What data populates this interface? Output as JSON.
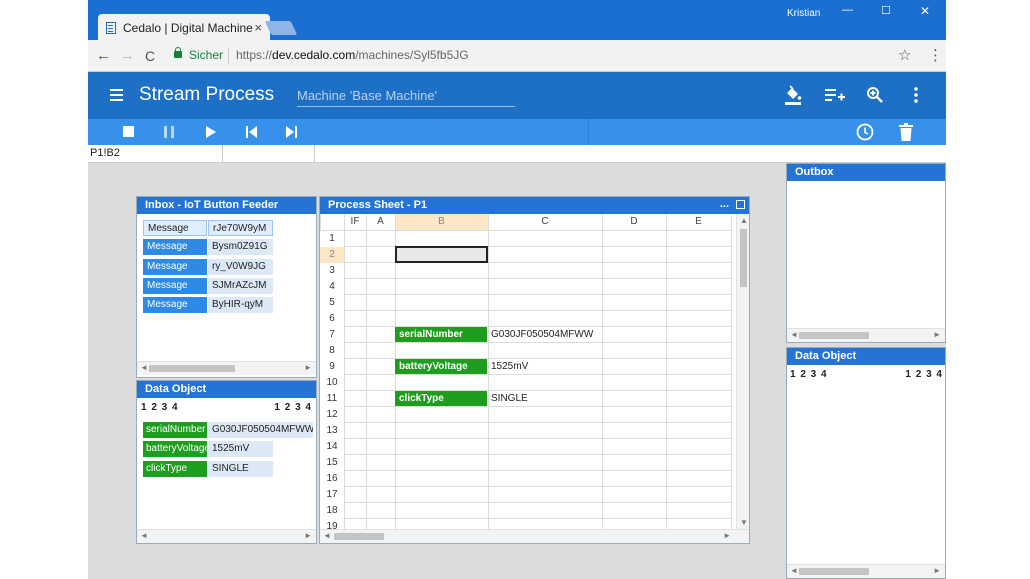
{
  "browser": {
    "tab_title": "Cedalo | Digital Machine",
    "tab_close": "×",
    "user": "Kristian",
    "win_minimize": "—",
    "win_maximize": "☐",
    "win_close": "✕",
    "back": "←",
    "forward": "→",
    "reload": "C",
    "secure_label": "Sicher",
    "url_scheme": "https://",
    "url_host": "dev.cedalo.com",
    "url_path": "/machines/Syl5fb5JG",
    "bookmark": "☆",
    "menu": "⋮"
  },
  "app": {
    "title": "Stream Process",
    "machine_label": "Machine 'Base Machine'",
    "icons": [
      "paint-bucket-icon",
      "add-list-icon",
      "zoom-icon",
      "more-vert-icon"
    ],
    "controls": [
      "stop-icon",
      "pause-icon",
      "play-icon",
      "step-back-icon",
      "step-forward-icon",
      "clock-icon",
      "trash-icon"
    ],
    "formula_cell_ref": "P1!B2"
  },
  "inbox": {
    "title": "Inbox - IoT Button Feeder",
    "messages": [
      {
        "key": "Message",
        "value": "rJe70W9yM"
      },
      {
        "key": "Message",
        "value": "Bysm0Z91G"
      },
      {
        "key": "Message",
        "value": "ry_V0W9JG"
      },
      {
        "key": "Message",
        "value": "SJMrAZcJM"
      },
      {
        "key": "Message",
        "value": "ByHIR-qyM"
      }
    ]
  },
  "inbox_data_object": {
    "title": "Data Object",
    "pager_left": "1 2 3 4",
    "pager_right": "1 2 3 4",
    "rows": [
      {
        "key": "serialNumber",
        "value": "G030JF050504MFWW"
      },
      {
        "key": "batteryVoltage",
        "value": "1525mV"
      },
      {
        "key": "clickType",
        "value": "SINGLE"
      }
    ]
  },
  "sheet": {
    "title": "Process Sheet - P1",
    "more": "...",
    "columns": [
      "IF",
      "A",
      "B",
      "C",
      "D",
      "E"
    ],
    "rows": [
      "1",
      "2",
      "3",
      "4",
      "5",
      "6",
      "7",
      "8",
      "9",
      "10",
      "11",
      "12",
      "13",
      "14",
      "15",
      "16",
      "17",
      "18",
      "19"
    ],
    "cells": [
      {
        "key": "serialNumber",
        "value": "G030JF050504MFWW"
      },
      {
        "key": "batteryVoltage",
        "value": "1525mV"
      },
      {
        "key": "clickType",
        "value": "SINGLE"
      }
    ]
  },
  "outbox": {
    "title": "Outbox"
  },
  "outbox_data_object": {
    "title": "Data Object",
    "pager_left": "1 2 3 4",
    "pager_right": "1 2 3 4"
  },
  "scroll_arrows": {
    "left": "◄",
    "right": "►",
    "up": "▲",
    "down": "▼"
  }
}
